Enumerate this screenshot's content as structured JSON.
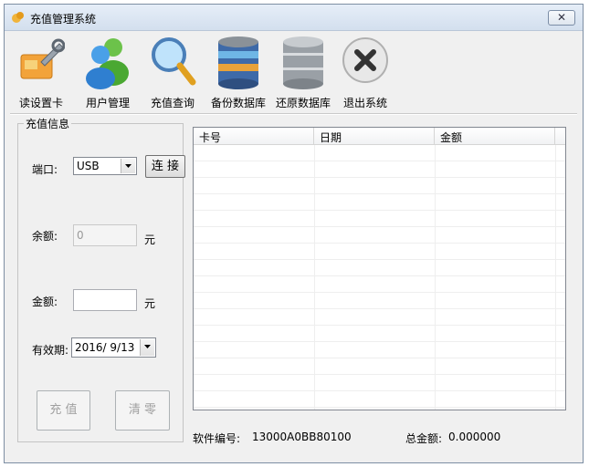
{
  "window": {
    "title": "充值管理系统",
    "close_symbol": "✕"
  },
  "toolbar": {
    "items": [
      {
        "label": "读设置卡",
        "icon": "wrench-card-icon"
      },
      {
        "label": "用户管理",
        "icon": "users-icon"
      },
      {
        "label": "充值查询",
        "icon": "magnifier-icon"
      },
      {
        "label": "备份数据库",
        "icon": "database-backup-icon"
      },
      {
        "label": "还原数据库",
        "icon": "database-restore-icon"
      },
      {
        "label": "退出系统",
        "icon": "exit-x-icon"
      }
    ]
  },
  "recharge": {
    "group_title": "充值信息",
    "port_label": "端口:",
    "port_value": "USB",
    "connect_label": "连 接",
    "balance_label": "余额:",
    "balance_value": "0",
    "unit": "元",
    "amount_label": "金额:",
    "amount_value": "",
    "expiry_label": "有效期:",
    "expiry_value": "2016/  9/13",
    "recharge_button": "充 值",
    "clear_button": "清 零"
  },
  "table": {
    "columns": [
      "卡号",
      "日期",
      "金额"
    ],
    "rows": []
  },
  "footer": {
    "software_id_label": "软件编号:",
    "software_id": "13000A0BB80100",
    "total_label": "总金额:",
    "total_value": "0.000000"
  },
  "colors": {
    "titlebar": "#d3dfee",
    "window_bg": "#f0f0f0",
    "grid_line": "#eeeeee"
  }
}
